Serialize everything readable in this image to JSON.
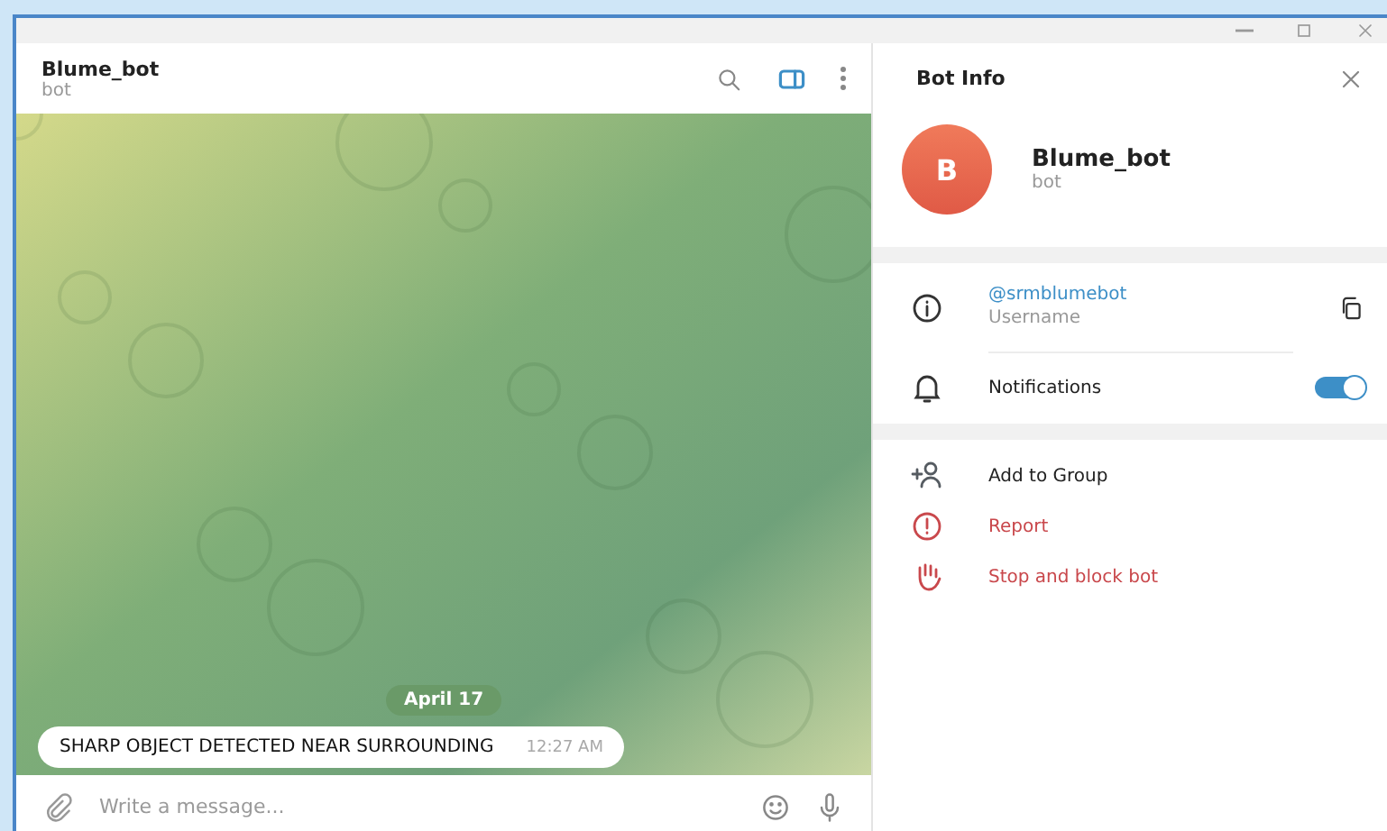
{
  "chat": {
    "title": "Blume_bot",
    "subtitle": "bot",
    "date": "April 17",
    "messages": [
      {
        "text": "SHARP OBJECT DETECTED NEAR SURROUNDING",
        "time": "12:27 AM"
      }
    ],
    "input": {
      "placeholder": "Write a message..."
    }
  },
  "panel": {
    "title": "Bot Info",
    "avatar_letter": "B",
    "name": "Blume_bot",
    "subtitle": "bot",
    "username": {
      "value": "@srmblumebot",
      "label": "Username"
    },
    "notifications": {
      "label": "Notifications",
      "on": true
    },
    "actions": [
      {
        "kind": "add",
        "label": "Add to Group",
        "danger": false
      },
      {
        "kind": "report",
        "label": "Report",
        "danger": true
      },
      {
        "kind": "block",
        "label": "Stop and block bot",
        "danger": true
      }
    ]
  }
}
